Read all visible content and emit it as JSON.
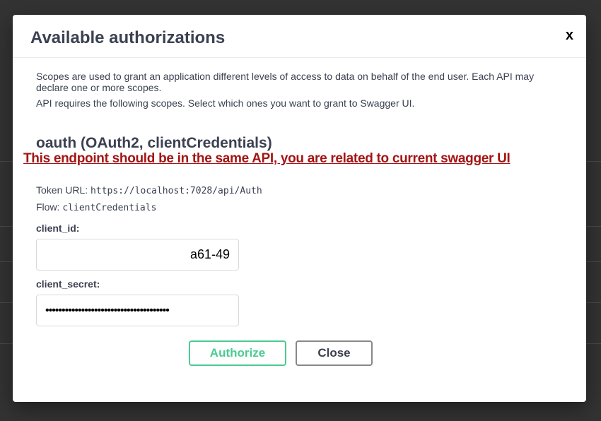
{
  "modal": {
    "title": "Available authorizations",
    "close_icon": "x"
  },
  "scopes": {
    "description": "Scopes are used to grant an application different levels of access to data on behalf of the end user. Each API may declare one or more scopes.",
    "requirement": "API requires the following scopes. Select which ones you want to grant to Swagger UI."
  },
  "scheme": {
    "heading": "oauth (OAuth2, clientCredentials)",
    "annotation": "This endpoint should be in the same API, you are related to current swagger UI",
    "token_url_label": "Token URL:",
    "token_url": "https://localhost:7028/api/Auth",
    "flow_label": "Flow:",
    "flow": "clientCredentials"
  },
  "form": {
    "client_id_label": "client_id:",
    "client_id_visible_value": "a61-49",
    "client_secret_label": "client_secret:",
    "client_secret_masked": "••••••••••••••••••••••••••••••••••••••"
  },
  "buttons": {
    "authorize": "Authorize",
    "close": "Close"
  }
}
